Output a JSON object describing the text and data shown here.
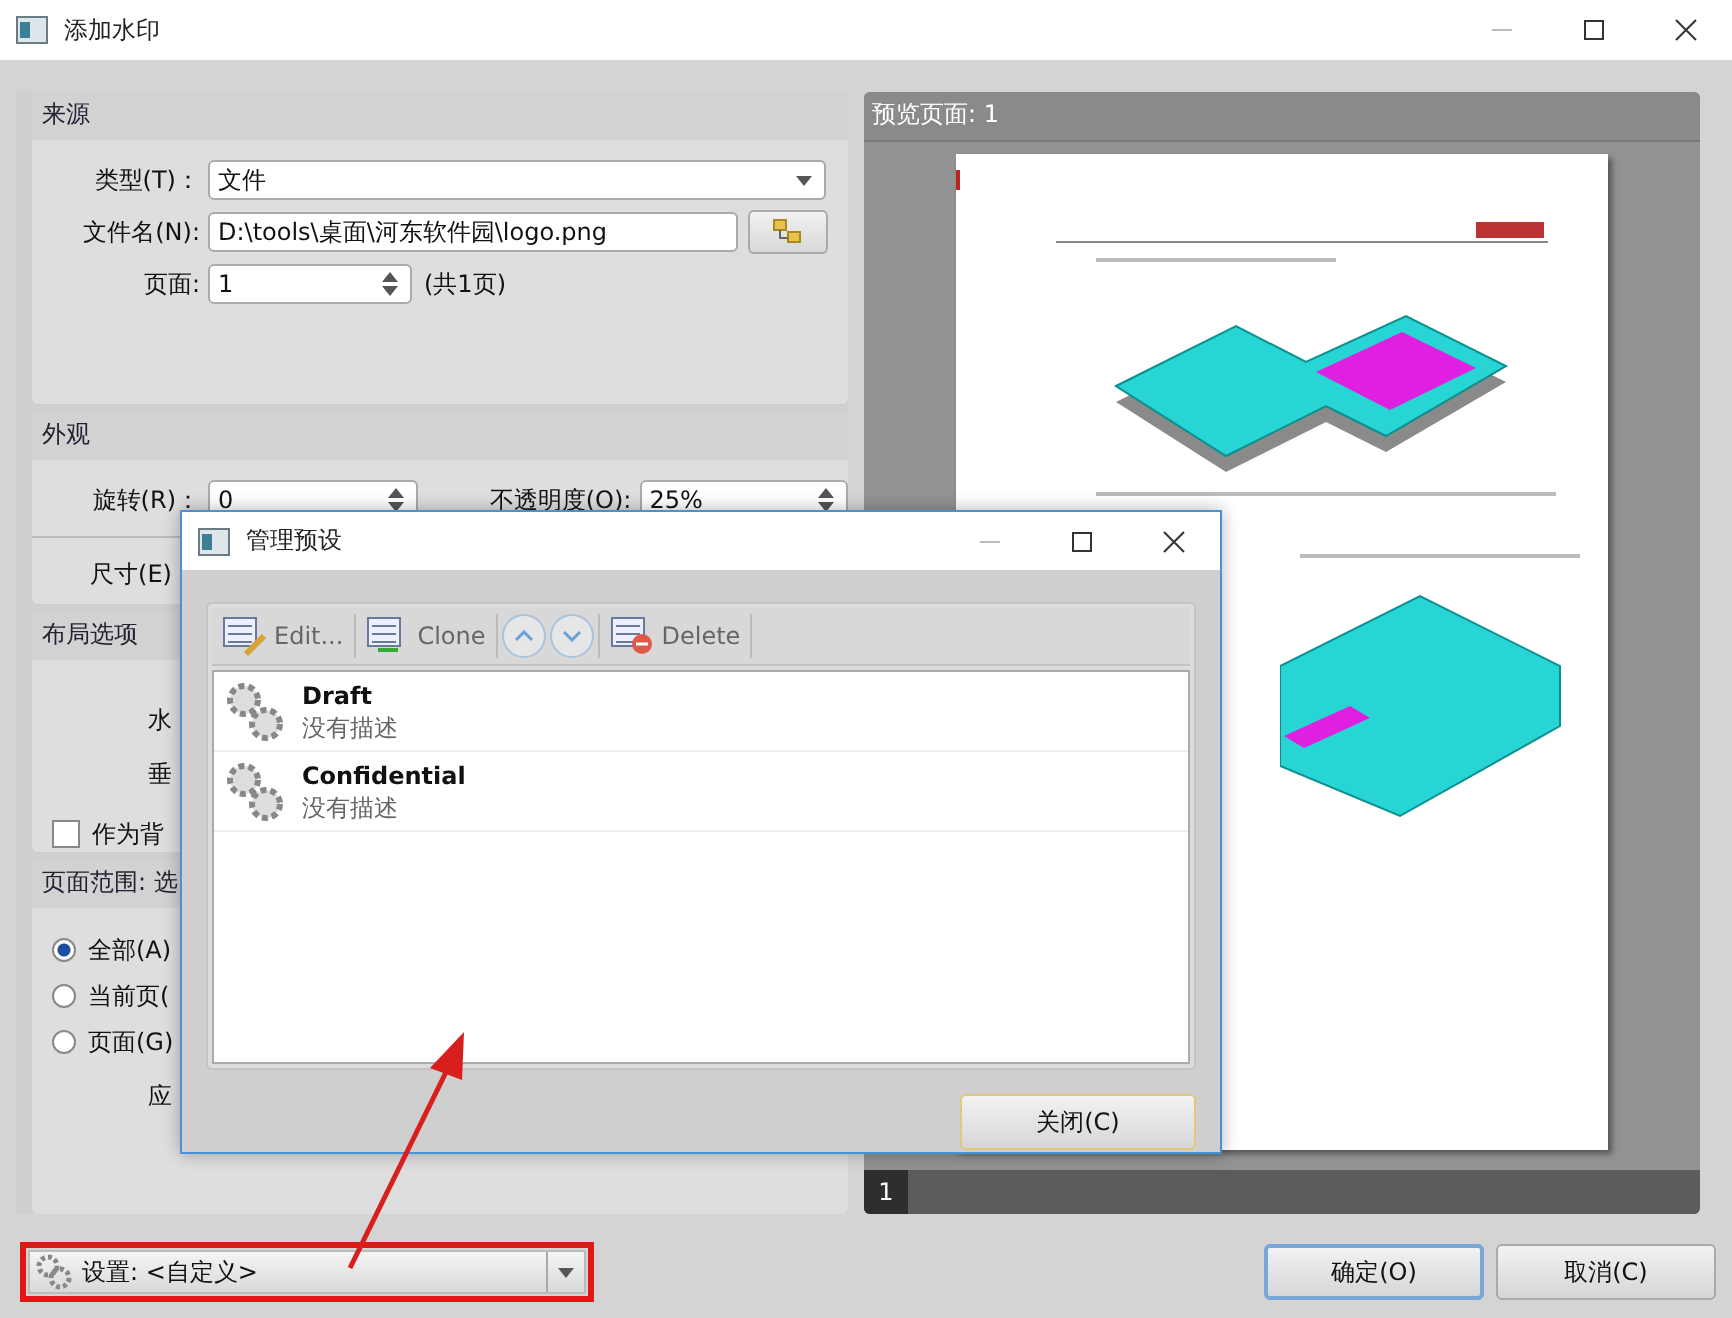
{
  "window": {
    "title": "添加水印"
  },
  "source": {
    "title": "来源",
    "type_label": "类型(T)：",
    "type_value": "文件",
    "filename_label": "文件名(N):",
    "filename_value": "D:\\tools\\桌面\\河东软件园\\logo.png",
    "page_label": "页面:",
    "page_value": "1",
    "page_total": "(共1页)"
  },
  "appearance": {
    "title": "外观",
    "rotation_label": "旋转(R)：",
    "rotation_value": "0",
    "opacity_label": "不透明度(O):",
    "opacity_value": "25%",
    "size_label": "尺寸(E)"
  },
  "layout": {
    "title": "布局选项",
    "horizontal_label": "水",
    "vertical_label": "垂",
    "background_checkbox": {
      "label": "作为背",
      "checked": false
    }
  },
  "page_range": {
    "title": "页面范围: 选",
    "options": [
      {
        "label": "全部(A)",
        "selected": true
      },
      {
        "label": "当前页(",
        "selected": false
      },
      {
        "label": "页面(G)",
        "selected": false
      }
    ],
    "apply_label": "应"
  },
  "preview": {
    "title": "预览页面: 1",
    "pages": [
      {
        "label": "1",
        "selected": true
      }
    ]
  },
  "settings": {
    "value": "设置: <自定义>"
  },
  "buttons": [
    {
      "label": "确定(O)",
      "default": true
    },
    {
      "label": "取消(C)",
      "default": false
    }
  ],
  "dialog": {
    "title": "管理预设",
    "toolbar": [
      {
        "kind": "edit",
        "label": "Edit..."
      },
      {
        "kind": "clone",
        "label": "Clone"
      },
      {
        "kind": "up"
      },
      {
        "kind": "down"
      },
      {
        "kind": "delete",
        "label": "Delete"
      }
    ],
    "presets": [
      {
        "name": "Draft",
        "description": "没有描述"
      },
      {
        "name": "Confidential",
        "description": "没有描述"
      }
    ],
    "close_button": "关闭(C)"
  }
}
